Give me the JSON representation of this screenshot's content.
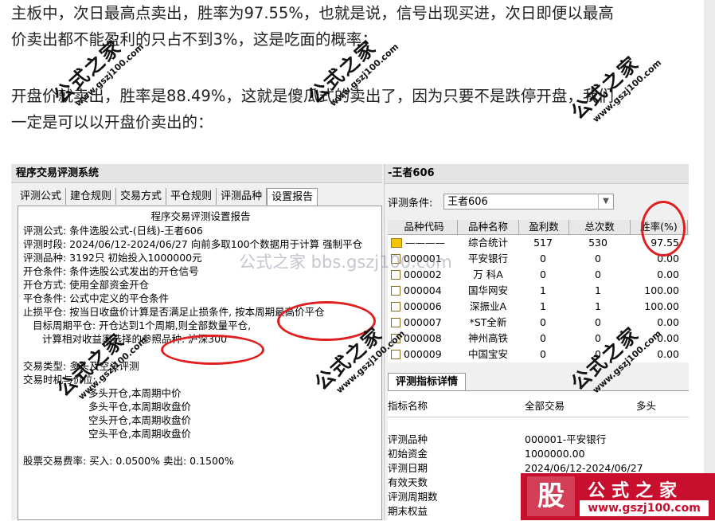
{
  "article": {
    "para1_line1": "主板中，次日最高点卖出，胜率为97.55%，也就是说，信号出现买进，次日即便以最高",
    "para1_line2": "价卖出都不能盈利的只占不到3%，这是吃面的概率；",
    "para2_line1": "开盘价就卖出，胜率是88.49%，这就是傻瓜式的卖出了，因为只要不是跌停开盘，我们",
    "para2_line2": "一定是可以以开盘价卖出的："
  },
  "left_window": {
    "title": "程序交易评测系统",
    "tabs": [
      {
        "label": "评测公式"
      },
      {
        "label": "建仓规则"
      },
      {
        "label": "交易方式"
      },
      {
        "label": "平仓规则"
      },
      {
        "label": "评测品种"
      },
      {
        "label": "设置报告"
      }
    ],
    "report": {
      "heading": "程序交易评测设置报告",
      "lines": [
        "评测公式: 条件选股公式-(日线)-王者606",
        "评测时段: 2024/06/12-2024/06/27 向前多取100个数据用于计算 强制平仓",
        "评测品种: 3192只 初始投入1000000元",
        "开仓条件: 条件选股公式发出的开仓信号",
        "开仓方式: 使用全部资金开仓",
        "平仓条件: 公式中定义的平仓条件",
        "止损平仓: 按当日收盘价计算是否满足止损条件, 按本周期最高价平仓",
        "目标周期平仓: 开仓达到1个周期,则全部数量平仓,",
        "计算相对收益率选择的参照品种: 沪深300",
        "交易类型: 多头及空头评测",
        "交易时机与价位:",
        "多头开仓,本周期中价",
        "多头平仓,本周期收盘价",
        "空头开仓,本周期收盘价",
        "空头平仓,本周期收盘价",
        "股票交易费率: 买入: 0.0500%  卖出: 0.1500%"
      ]
    }
  },
  "right_window": {
    "title": "-王者606",
    "condition_label": "评测条件:",
    "condition_value": "王者606",
    "columns": [
      "品种代码",
      "品种名称",
      "盈利数",
      "总次数",
      "胜率(%)"
    ],
    "rows": [
      {
        "code": "————",
        "name": "综合统计",
        "profit": "517",
        "total": "530",
        "rate": "97.55"
      },
      {
        "code": "000001",
        "name": "平安银行",
        "profit": "0",
        "total": "0",
        "rate": "0.00"
      },
      {
        "code": "000002",
        "name": "万 科A",
        "profit": "0",
        "total": "0",
        "rate": "0.00"
      },
      {
        "code": "000004",
        "name": "国华网安",
        "profit": "1",
        "total": "1",
        "rate": "100.00"
      },
      {
        "code": "000006",
        "name": "深振业A",
        "profit": "1",
        "total": "1",
        "rate": "100.00"
      },
      {
        "code": "000007",
        "name": "*ST全新",
        "profit": "0",
        "total": "0",
        "rate": "0.00"
      },
      {
        "code": "000008",
        "name": "神州高铁",
        "profit": "0",
        "total": "0",
        "rate": "0.00"
      },
      {
        "code": "000009",
        "name": "中国宝安",
        "profit": "0",
        "total": "0",
        "rate": "0.00"
      }
    ],
    "detail_tab": "评测指标详情",
    "detail_headers": [
      "指标名称",
      "全部交易",
      "多头"
    ],
    "detail_rows": [
      {
        "label": "评测品种",
        "value": "000001-平安银行"
      },
      {
        "label": "初始资金",
        "value": "1000000.00"
      },
      {
        "label": "评测日期",
        "value": "2024/06/12-2024/06/27"
      },
      {
        "label": "有效天数",
        "value": ""
      },
      {
        "label": "评测周期数",
        "value": ""
      },
      {
        "label": "期末权益",
        "value": ""
      }
    ]
  },
  "watermarks": {
    "brand": "公式之家",
    "site": "www.gszj100.com",
    "center": "公式之家 bbs.gszj100.com"
  },
  "logo": {
    "mark": "股",
    "name": "公式之家",
    "url": "www.gszj100.com"
  },
  "colors": {
    "highlight_circle": "#e02020",
    "logo_bg": "#c8102e",
    "summary_icon": "#f3c300"
  }
}
